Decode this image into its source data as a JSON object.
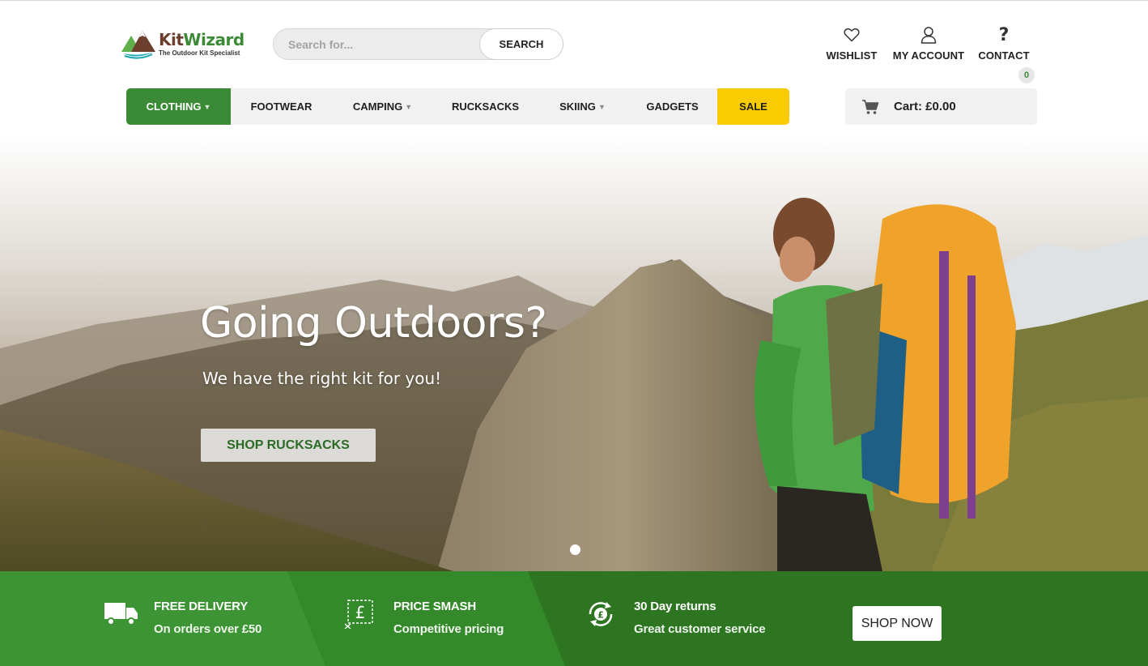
{
  "brand": {
    "name_part1": "Kit",
    "name_part2": "Wizard",
    "tagline": "The Outdoor Kit Specialist",
    "colors": {
      "green": "#3b8b36",
      "brown": "#6b3e2e",
      "teal": "#1fa6b3",
      "sale_yellow": "#f8cb02",
      "band_green": "#2d7a22"
    }
  },
  "search": {
    "placeholder": "Search for...",
    "button_label": "SEARCH"
  },
  "header_links": [
    {
      "label": "WISHLIST",
      "icon": "heart-icon"
    },
    {
      "label": "MY ACCOUNT",
      "icon": "user-icon"
    },
    {
      "label": "CONTACT",
      "icon": "question-icon"
    }
  ],
  "cart": {
    "label": "Cart: £0.00",
    "count": "0",
    "icon": "cart-icon"
  },
  "nav": {
    "items": [
      {
        "label": "CLOTHING",
        "dropdown": true,
        "active": true
      },
      {
        "label": "FOOTWEAR",
        "dropdown": false
      },
      {
        "label": "CAMPING",
        "dropdown": true
      },
      {
        "label": "RUCKSACKS",
        "dropdown": false
      },
      {
        "label": "SKIING",
        "dropdown": true
      },
      {
        "label": "GADGETS",
        "dropdown": false
      },
      {
        "label": "SALE",
        "dropdown": false,
        "highlight": true
      }
    ]
  },
  "hero": {
    "title": "Going Outdoors?",
    "subtitle": "We have the right kit for you!",
    "button_label": "SHOP RUCKSACKS",
    "active_slide": 1,
    "slide_count": 1
  },
  "features": [
    {
      "title": "FREE DELIVERY",
      "subtitle": "On orders over £50",
      "icon": "truck-icon"
    },
    {
      "title": "PRICE SMASH",
      "subtitle": "Competitive pricing",
      "icon": "price-tag-icon"
    },
    {
      "title": "30 Day returns",
      "subtitle": "Great customer service",
      "icon": "returns-icon"
    }
  ],
  "cta": {
    "label": "SHOP NOW"
  }
}
